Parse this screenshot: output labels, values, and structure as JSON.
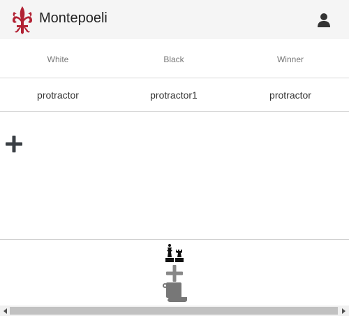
{
  "app": {
    "title": "Montepoeli",
    "logo_icon": "fleur-de-lis-icon",
    "logo_color": "#b22234"
  },
  "header": {
    "user_icon": "user-icon"
  },
  "games_table": {
    "columns": [
      "White",
      "Black",
      "Winner"
    ],
    "rows": [
      {
        "white": "protractor",
        "black": "protractor1",
        "winner": "protractor"
      }
    ]
  },
  "actions": {
    "add_icon": "plus-icon"
  },
  "bottom_nav": {
    "items": [
      {
        "icon": "chess-pieces-icon"
      },
      {
        "icon": "plus-icon"
      },
      {
        "icon": "scroll-icon"
      }
    ]
  }
}
